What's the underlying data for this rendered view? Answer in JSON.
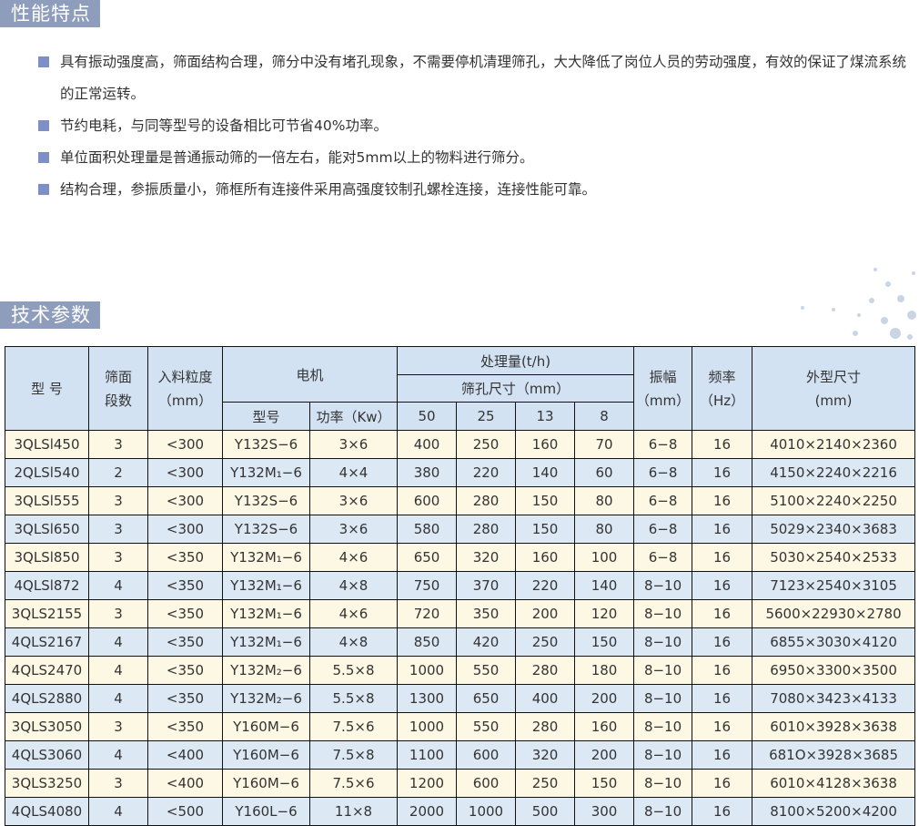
{
  "sections": {
    "performance_title": "性能特点",
    "tech_title": "技术参数"
  },
  "features": [
    "具有振动强度高，筛面结构合理，筛分中没有堵孔现象，不需要停机清理筛孔，大大降低了岗位人员的劳动强度，有效的保证了煤流系统的正常运转。",
    "节约电耗，与同等型号的设备相比可节省40%功率。",
    "单位面积处理量是普通振动筛的一倍左右，能对5mm以上的物料进行筛分。",
    "结构合理，参振质量小，筛框所有连接件采用高强度铰制孔螺栓连接，连接性能可靠。"
  ],
  "table": {
    "headers": {
      "model": "型 号",
      "deck_line1": "筛面",
      "deck_line2": "段数",
      "feed_line1": "入料粒度",
      "feed_line2": "（mm）",
      "motor": "电机",
      "motor_model": "型号",
      "motor_power": "功率（Kw）",
      "capacity": "处理量(t/h)",
      "aperture": "筛孔尺寸（mm）",
      "ap_50": "50",
      "ap_25": "25",
      "ap_13": "13",
      "ap_8": "8",
      "amp_line1": "振幅",
      "amp_line2": "（mm）",
      "freq_line1": "频率",
      "freq_line2": "（Hz）",
      "dim_line1": "外型尺寸",
      "dim_line2": "(mm)"
    },
    "rows": [
      [
        "3QLSl450",
        "3",
        "<300",
        "Y132S−6",
        "3×6",
        "400",
        "250",
        "160",
        "70",
        "6−8",
        "16",
        "4010×2140×2360"
      ],
      [
        "2QLSl540",
        "2",
        "<300",
        "Y132M₁−6",
        "4×4",
        "380",
        "220",
        "140",
        "60",
        "6−8",
        "16",
        "4150×2240×2216"
      ],
      [
        "3QLSl555",
        "3",
        "<300",
        "Y132S−6",
        "3×6",
        "600",
        "280",
        "150",
        "80",
        "6−8",
        "16",
        "5100×2240×2250"
      ],
      [
        "3QLSl650",
        "3",
        "<300",
        "Y132S−6",
        "3×6",
        "580",
        "280",
        "150",
        "80",
        "6−8",
        "16",
        "5029×2340×3683"
      ],
      [
        "3QLSl850",
        "3",
        "<350",
        "Y132M₁−6",
        "4×6",
        "650",
        "320",
        "160",
        "100",
        "6−8",
        "16",
        "5030×2540×2533"
      ],
      [
        "4QLSl872",
        "4",
        "<350",
        "Y132M₁−6",
        "4×8",
        "750",
        "370",
        "220",
        "140",
        "8−10",
        "16",
        "7123×2540×3105"
      ],
      [
        "3QLS2155",
        "3",
        "<350",
        "Y132M₁−6",
        "4×6",
        "720",
        "350",
        "200",
        "120",
        "8−10",
        "16",
        "5600×22930×2780"
      ],
      [
        "4QLS2167",
        "4",
        "<350",
        "Y132M₁−6",
        "4×8",
        "850",
        "420",
        "250",
        "150",
        "8−10",
        "16",
        "6855×3030×4120"
      ],
      [
        "4QLS2470",
        "4",
        "<350",
        "Y132M₂−6",
        "5.5×8",
        "1000",
        "550",
        "280",
        "180",
        "8−10",
        "16",
        "6950×3300×3500"
      ],
      [
        "4QLS2880",
        "4",
        "<350",
        "Y132M₂−6",
        "5.5×8",
        "1300",
        "650",
        "400",
        "200",
        "8−10",
        "16",
        "7080×3423×4133"
      ],
      [
        "3QLS3050",
        "3",
        "<350",
        "Y160M−6",
        "7.5×6",
        "1000",
        "550",
        "280",
        "160",
        "8−10",
        "16",
        "6010×3928×3638"
      ],
      [
        "4QLS3060",
        "4",
        "<400",
        "Y160M−6",
        "7.5×8",
        "1100",
        "600",
        "320",
        "200",
        "8−10",
        "16",
        "681O×3928×3685"
      ],
      [
        "3QLS3250",
        "3",
        "<400",
        "Y160M−6",
        "7.5×6",
        "1200",
        "600",
        "250",
        "150",
        "8−10",
        "16",
        "6010×4128×3638"
      ],
      [
        "4QLS4080",
        "4",
        "<500",
        "Y160L−6",
        "11×8",
        "2000",
        "1000",
        "500",
        "300",
        "8−10",
        "16",
        "8100×5200×4200"
      ]
    ]
  }
}
